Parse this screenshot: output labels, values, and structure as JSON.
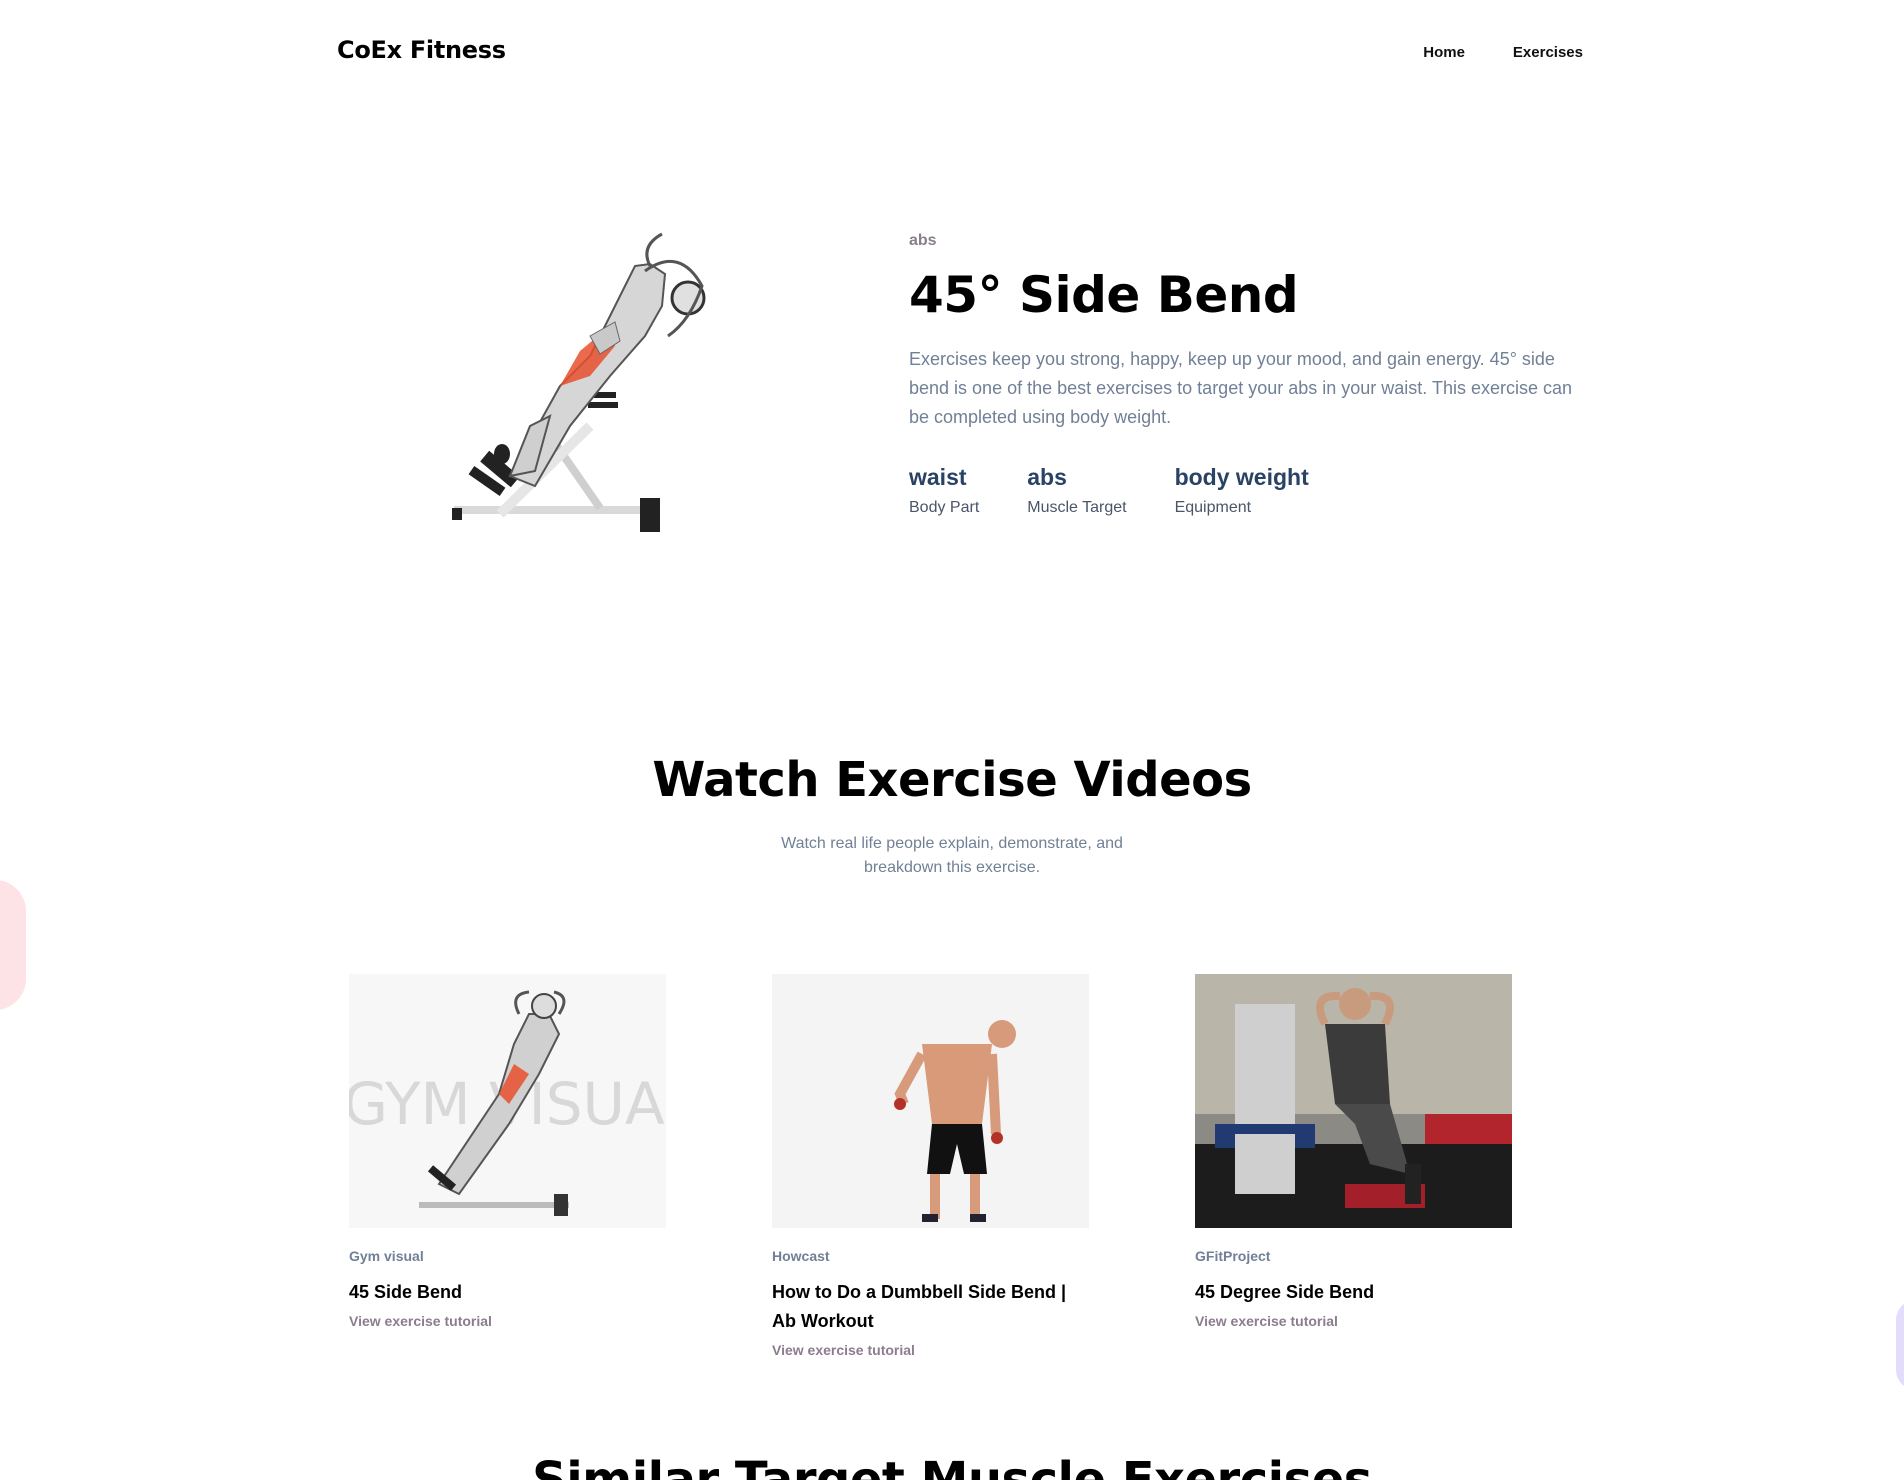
{
  "header": {
    "brand": "CoEx Fitness",
    "nav": [
      "Home",
      "Exercises"
    ]
  },
  "exercise": {
    "tag": "abs",
    "title": "45° Side Bend",
    "description": "Exercises keep you strong, happy, keep up your mood, and gain energy. 45° side bend is one of the best exercises to target your abs in your waist. This exercise can be completed using body weight.",
    "stats": [
      {
        "value": "waist",
        "label": "Body Part"
      },
      {
        "value": "abs",
        "label": "Muscle Target"
      },
      {
        "value": "body weight",
        "label": "Equipment"
      }
    ]
  },
  "videos_section": {
    "title": "Watch Exercise Videos",
    "subtitle": "Watch real life people explain, demonstrate, and breakdown this exercise.",
    "videos": [
      {
        "channel": "Gym visual",
        "title": "45 Side Bend",
        "link": "View exercise tutorial",
        "watermark": "GYM VISUA"
      },
      {
        "channel": "Howcast",
        "title": "How to Do a Dumbbell Side Bend | Ab Workout",
        "link": "View exercise tutorial"
      },
      {
        "channel": "GFitProject",
        "title": "45 Degree Side Bend",
        "link": "View exercise tutorial"
      }
    ]
  },
  "next_section": {
    "title": "Similar Target Muscle Exercises"
  },
  "colors": {
    "accent_text": "#2a4365",
    "muted": "#718096",
    "tag": "#8b7c8e",
    "muscle_highlight": "#e8502f"
  }
}
